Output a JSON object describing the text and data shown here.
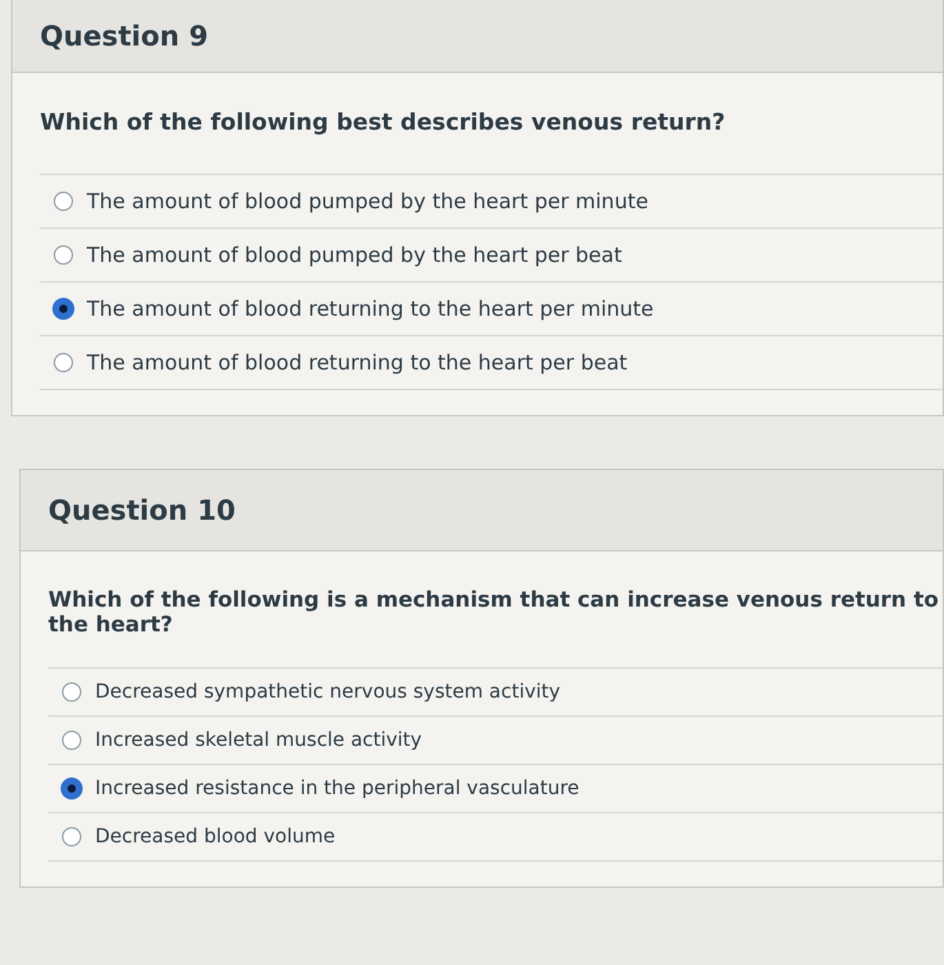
{
  "questions": [
    {
      "title": "Question 9",
      "prompt": "Which of the following best describes venous return?",
      "options": [
        {
          "label": "The amount of blood pumped by the heart per minute",
          "selected": false
        },
        {
          "label": "The amount of blood pumped by the heart per beat",
          "selected": false
        },
        {
          "label": "The amount of blood returning to the heart per minute",
          "selected": true
        },
        {
          "label": "The amount of blood returning to the heart per beat",
          "selected": false
        }
      ]
    },
    {
      "title": "Question 10",
      "prompt": "Which of the following is a mechanism that can increase venous return to the heart?",
      "options": [
        {
          "label": "Decreased sympathetic nervous system activity",
          "selected": false
        },
        {
          "label": "Increased skeletal muscle activity",
          "selected": false
        },
        {
          "label": "Increased resistance in the peripheral vasculature",
          "selected": true
        },
        {
          "label": "Decreased blood volume",
          "selected": false
        }
      ]
    }
  ]
}
